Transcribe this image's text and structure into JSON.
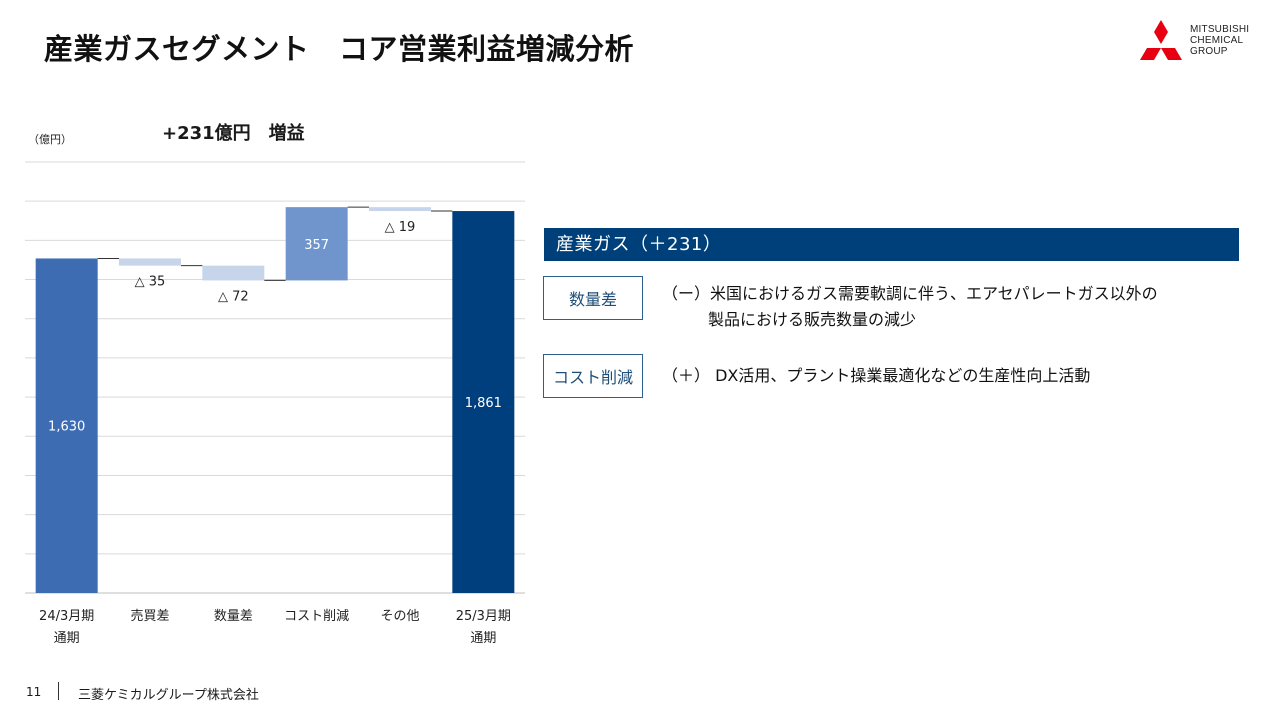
{
  "page": {
    "title": "産業ガスセグメント　コア営業利益増減分析",
    "logo_lines": [
      "MITSUBISHI",
      "CHEMICAL",
      "GROUP"
    ],
    "unit": "（億円）",
    "headline": "+231億円　増益",
    "page_number": "11",
    "company": "三菱ケミカルグループ株式会社"
  },
  "panel": {
    "header": "産業ガス（＋231）",
    "items": [
      {
        "tag": "数量差",
        "line1": "（ー）米国におけるガス需要軟調に伴う、エアセパレートガス以外の",
        "line2": "製品における販売数量の減少"
      },
      {
        "tag": "コスト削減",
        "line1": "（＋） DX活用、プラント操業最適化などの生産性向上活動",
        "line2": ""
      }
    ]
  },
  "chart_data": {
    "type": "waterfall",
    "categories": [
      "24/3月期\n通期",
      "売買差",
      "数量差",
      "コスト削減",
      "その他",
      "25/3月期\n通期"
    ],
    "values": [
      1630,
      -35,
      -72,
      357,
      -19,
      1861
    ],
    "kinds": [
      "total",
      "delta",
      "delta",
      "delta",
      "delta",
      "total"
    ],
    "data_labels": [
      "1,630",
      "△ 35",
      "△ 72",
      "357",
      "△ 19",
      "1,861"
    ],
    "ylim": [
      0,
      2100
    ],
    "grid": true,
    "colors": {
      "start_total": "#3d6cb3",
      "end_total": "#003f7d",
      "negative": "#c7d5ea",
      "positive": "#6f95cc",
      "grid": "#d9d9d9",
      "connector": "#333333"
    }
  },
  "colors": {
    "brand_red": "#e60012",
    "header_bg": "#00407a",
    "tag_border": "#2f5f8f"
  }
}
